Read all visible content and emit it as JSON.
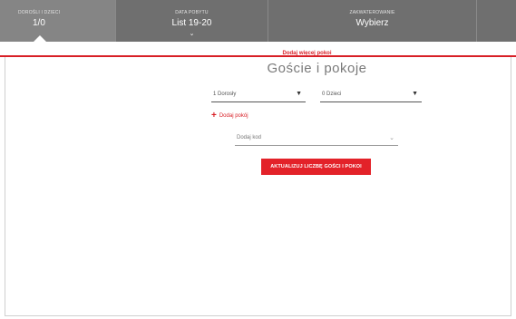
{
  "header": {
    "guests": {
      "label": "DOROŚLI I DZIECI",
      "value": "1/0"
    },
    "dates": {
      "label": "DATA POBYTU",
      "value": "List 19-20",
      "chevron": "chevron-down-icon"
    },
    "accommodation": {
      "label": "ZAKWATEROWANIE",
      "value": "Wybierz"
    }
  },
  "more_rooms_link": "Dodaj więcej pokoi",
  "panel": {
    "title": "Goście i pokoje",
    "adults": {
      "value": "1 Dorosły",
      "icon": "chevron-down-icon"
    },
    "children": {
      "value": "0 Dzieci",
      "icon": "chevron-down-icon"
    },
    "add_room": {
      "label": "Dodaj pokój",
      "icon": "plus-icon"
    },
    "code": {
      "value": "Dodaj kod",
      "icon": "chevron-down-icon"
    },
    "update_button": "AKTUALIZUJ LICZBĘ GOŚCI I POKOI"
  },
  "colors": {
    "accent": "#d81f26",
    "header_bg": "#6f6f6f",
    "header_active_bg": "#858585"
  }
}
